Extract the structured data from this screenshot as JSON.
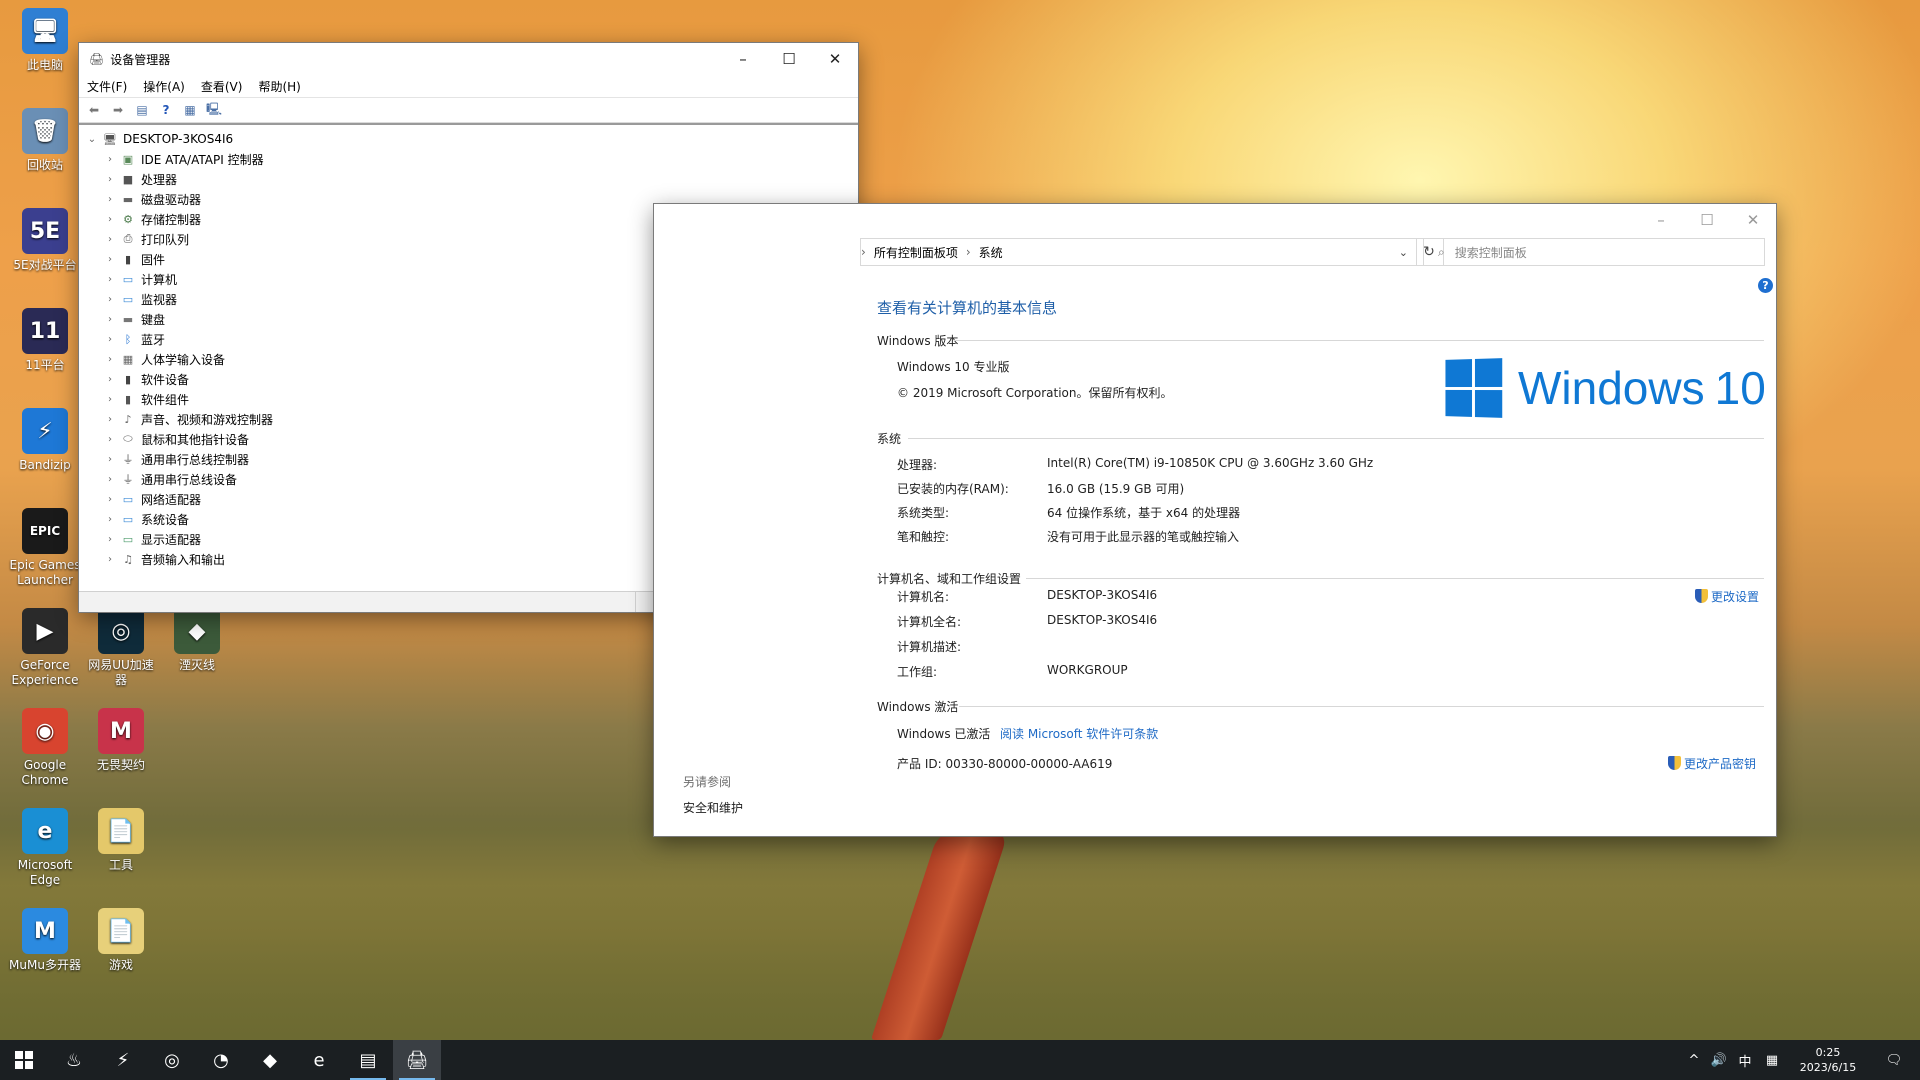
{
  "desktop": {
    "icons": [
      {
        "label": "此电脑",
        "glyph": "🖥",
        "color": "#2f7fd3"
      },
      {
        "label": "回收站",
        "glyph": "🗑",
        "color": "#6a8fb5"
      },
      {
        "label": "5E对战平台",
        "glyph": "5E",
        "color": "#3b3f8f"
      },
      {
        "label": "11平台",
        "glyph": "11",
        "color": "#2a2a55"
      },
      {
        "label": "Bandizip",
        "glyph": "⚡",
        "color": "#1e78d6"
      },
      {
        "label": "Epic Games Launcher",
        "glyph": "EPIC",
        "color": "#1a1a1a"
      },
      {
        "label": "GeForce Experience",
        "glyph": "▶",
        "color": "#2a2a2a"
      },
      {
        "label": "网易UU加速器",
        "glyph": "◎",
        "color": "#0f2b3a"
      },
      {
        "label": "湮灭线",
        "glyph": "◆",
        "color": "#3c5a3a"
      },
      {
        "label": "Google Chrome",
        "glyph": "◉",
        "color": "#d8442f"
      },
      {
        "label": "无畏契约",
        "glyph": "M",
        "color": "#c8334a"
      },
      {
        "label": "Microsoft Edge",
        "glyph": "e",
        "color": "#1a8fd4"
      },
      {
        "label": "工具",
        "glyph": "📄",
        "color": "#e4c86a"
      },
      {
        "label": "MuMu多开器",
        "glyph": "M",
        "color": "#2b8ae0"
      },
      {
        "label": "游戏",
        "glyph": "📄",
        "color": "#e7d07a"
      }
    ]
  },
  "devmgr": {
    "title": "设备管理器",
    "title_icon": "device-manager-icon",
    "menu": [
      "文件(F)",
      "操作(A)",
      "查看(V)",
      "帮助(H)"
    ],
    "root": "DESKTOP-3KOS4I6",
    "items": [
      {
        "label": "IDE ATA/ATAPI 控制器",
        "icon": "ide-controller-icon",
        "glyph": "▣",
        "color": "#5a8a5a"
      },
      {
        "label": "处理器",
        "icon": "processor-icon",
        "glyph": "■",
        "color": "#555"
      },
      {
        "label": "磁盘驱动器",
        "icon": "disk-drive-icon",
        "glyph": "▬",
        "color": "#666"
      },
      {
        "label": "存储控制器",
        "icon": "storage-controller-icon",
        "glyph": "⚙",
        "color": "#4a7a4a"
      },
      {
        "label": "打印队列",
        "icon": "printer-icon",
        "glyph": "⎙",
        "color": "#555"
      },
      {
        "label": "固件",
        "icon": "firmware-icon",
        "glyph": "▮",
        "color": "#444"
      },
      {
        "label": "计算机",
        "icon": "computer-icon",
        "glyph": "▭",
        "color": "#3a8ad6"
      },
      {
        "label": "监视器",
        "icon": "monitor-icon",
        "glyph": "▭",
        "color": "#3a8ad6"
      },
      {
        "label": "键盘",
        "icon": "keyboard-icon",
        "glyph": "▬",
        "color": "#777"
      },
      {
        "label": "蓝牙",
        "icon": "bluetooth-icon",
        "glyph": "ᛒ",
        "color": "#1f6fd0"
      },
      {
        "label": "人体学输入设备",
        "icon": "hid-icon",
        "glyph": "▦",
        "color": "#666"
      },
      {
        "label": "软件设备",
        "icon": "software-device-icon",
        "glyph": "▮",
        "color": "#444"
      },
      {
        "label": "软件组件",
        "icon": "software-component-icon",
        "glyph": "▮",
        "color": "#555"
      },
      {
        "label": "声音、视频和游戏控制器",
        "icon": "sound-icon",
        "glyph": "♪",
        "color": "#666"
      },
      {
        "label": "鼠标和其他指针设备",
        "icon": "mouse-icon",
        "glyph": "⬭",
        "color": "#666"
      },
      {
        "label": "通用串行总线控制器",
        "icon": "usb-controller-icon",
        "glyph": "⏚",
        "color": "#555"
      },
      {
        "label": "通用串行总线设备",
        "icon": "usb-device-icon",
        "glyph": "⏚",
        "color": "#555"
      },
      {
        "label": "网络适配器",
        "icon": "network-adapter-icon",
        "glyph": "▭",
        "color": "#3a8ad6"
      },
      {
        "label": "系统设备",
        "icon": "system-device-icon",
        "glyph": "▭",
        "color": "#3a8ad6"
      },
      {
        "label": "显示适配器",
        "icon": "display-adapter-icon",
        "glyph": "▭",
        "color": "#4a9a6a"
      },
      {
        "label": "音频输入和输出",
        "icon": "audio-io-icon",
        "glyph": "♫",
        "color": "#666"
      }
    ]
  },
  "system": {
    "breadcrumb": [
      "所有控制面板项",
      "系统"
    ],
    "search_placeholder": "搜索控制面板",
    "heading": "查看有关计算机的基本信息",
    "windows_edition": {
      "title": "Windows 版本",
      "edition": "Windows 10 专业版",
      "copyright": "© 2019 Microsoft Corporation。保留所有权利。",
      "logo_text": "Windows",
      "logo_num": "10"
    },
    "system": {
      "title": "系统",
      "rows": [
        {
          "label": "处理器:",
          "value": "Intel(R) Core(TM) i9-10850K CPU @ 3.60GHz   3.60 GHz"
        },
        {
          "label": "已安装的内存(RAM):",
          "value": "16.0 GB (15.9 GB 可用)"
        },
        {
          "label": "系统类型:",
          "value": "64 位操作系统，基于 x64 的处理器"
        },
        {
          "label": "笔和触控:",
          "value": "没有可用于此显示器的笔或触控输入"
        }
      ]
    },
    "computer": {
      "title": "计算机名、域和工作组设置",
      "change_link": "更改设置",
      "rows": [
        {
          "label": "计算机名:",
          "value": "DESKTOP-3KOS4I6"
        },
        {
          "label": "计算机全名:",
          "value": "DESKTOP-3KOS4I6"
        },
        {
          "label": "计算机描述:",
          "value": ""
        },
        {
          "label": "工作组:",
          "value": "WORKGROUP"
        }
      ]
    },
    "activation": {
      "title": "Windows 激活",
      "status": "Windows 已激活",
      "license_link": "阅读 Microsoft 软件许可条款",
      "product_id": "产品 ID: 00330-80000-00000-AA619",
      "change_key_link": "更改产品密钥"
    },
    "see_also": {
      "title": "另请参阅",
      "items": [
        "安全和维护"
      ]
    }
  },
  "taskbar": {
    "apps": [
      "steam-icon",
      "bandizip-icon",
      "uu-accelerator-icon",
      "obs-icon",
      "game-launcher-icon",
      "edge-icon",
      "control-panel-icon",
      "device-manager-icon"
    ],
    "tray": {
      "ime": "中",
      "time": "0:25",
      "date": "2023/6/15"
    }
  },
  "colors": {
    "accent": "#1e6ac6",
    "heading": "#1f5fa8",
    "taskbar": "#1b1f22"
  }
}
